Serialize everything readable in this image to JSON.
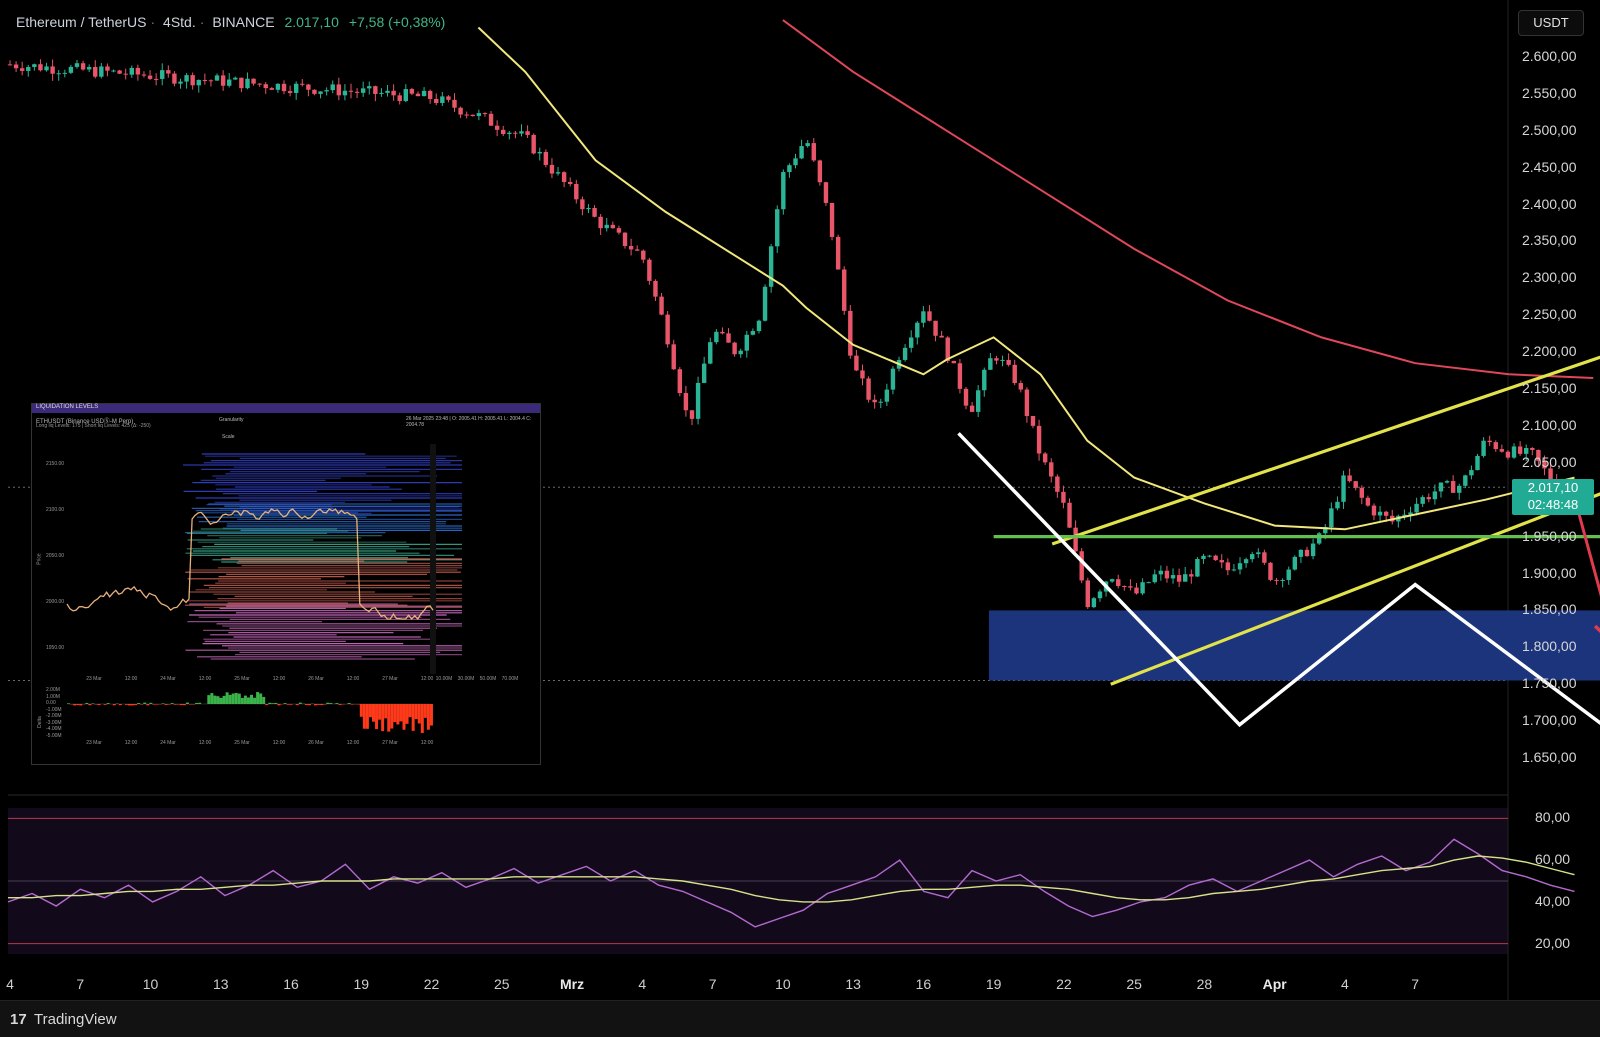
{
  "header": {
    "symbol": "Ethereum / TetherUS",
    "interval": "4Std.",
    "exchange": "BINANCE",
    "price": "2.017,10",
    "change": "+7,58 (+0,38%)"
  },
  "currency_button": "USDT",
  "price_tag": {
    "price": "2.017,10",
    "countdown": "02:48:48"
  },
  "footer": {
    "brand": "TradingView"
  },
  "colors": {
    "background": "#000000",
    "candle_up": "#2bb596",
    "candle_down": "#e9566a",
    "ma_fast": "#f1e77a",
    "ma_slow": "#e0475a",
    "channel": "#e2e24a",
    "support_line": "#63c04e",
    "demand_zone": "#1e3a8a",
    "projection": "#ffffff",
    "down_arrow": "#e03a4f",
    "rsi_line": "#b36ad0",
    "rsi_ma": "#d6e28a"
  },
  "inset": {
    "title": "LIQUIDATION LEVELS",
    "symbol": "ETHUSDT (Binance USDⓈ-M Perp)",
    "subtitle": "Long liq Levels: 175 | Short liq Levels: 425 (Δ: -250)",
    "ohlc": "26 Mar 2025 23:48 | O: 2005.41 H: 2005.41 L: 2004.4 C: 2004.78",
    "granularity_label": "Granularity",
    "scale_label": "Scale",
    "y_ticks": [
      "2150.00",
      "2100.00",
      "2050.00",
      "2000.00",
      "1950.00"
    ],
    "x_ticks": [
      "23 Mar",
      "12:00",
      "24 Mar",
      "12:00",
      "25 Mar",
      "12:00",
      "26 Mar",
      "12:00",
      "27 Mar",
      "12:00"
    ],
    "hist_ticks": [
      "10.00M",
      "30.00M",
      "50.00M",
      "70.00M"
    ],
    "delta_ticks": [
      "2.00M",
      "1.00M",
      "0.00",
      "-1.00M",
      "-2.00M",
      "-3.00M",
      "-4.00M",
      "-5.00M"
    ],
    "price_axis": "Price",
    "delta_axis": "Delta"
  },
  "chart_data": {
    "type": "candlestick",
    "title": "Ethereum / TetherUS · 4Std. · BINANCE",
    "y_axis": {
      "ticks": [
        "2.600,00",
        "2.550,00",
        "2.500,00",
        "2.450,00",
        "2.400,00",
        "2.350,00",
        "2.300,00",
        "2.250,00",
        "2.200,00",
        "2.150,00",
        "2.100,00",
        "2.050,00",
        "2.000,00",
        "1.950,00",
        "1.900,00",
        "1.850,00",
        "1.800,00",
        "1.750,00",
        "1.700,00",
        "1.650,00"
      ],
      "range": [
        1630,
        2625
      ]
    },
    "x_axis": {
      "ticks": [
        "4",
        "7",
        "10",
        "13",
        "16",
        "19",
        "22",
        "25",
        "Mrz",
        "4",
        "7",
        "10",
        "13",
        "16",
        "19",
        "22",
        "25",
        "28",
        "Apr",
        "4",
        "7"
      ]
    },
    "price_path": [
      {
        "t": 0,
        "p": 2590
      },
      {
        "t": 18,
        "p": 2545
      },
      {
        "t": 20,
        "p": 2520
      },
      {
        "t": 22,
        "p": 2490
      },
      {
        "t": 25,
        "p": 2380
      },
      {
        "t": 27,
        "p": 2330
      },
      {
        "t": 28,
        "p": 2230
      },
      {
        "t": 29,
        "p": 2100
      },
      {
        "t": 30,
        "p": 2230
      },
      {
        "t": 31,
        "p": 2200
      },
      {
        "t": 32,
        "p": 2250
      },
      {
        "t": 33,
        "p": 2440
      },
      {
        "t": 34,
        "p": 2490
      },
      {
        "t": 35,
        "p": 2380
      },
      {
        "t": 36,
        "p": 2180
      },
      {
        "t": 37,
        "p": 2120
      },
      {
        "t": 38,
        "p": 2200
      },
      {
        "t": 39,
        "p": 2260
      },
      {
        "t": 40,
        "p": 2200
      },
      {
        "t": 41,
        "p": 2120
      },
      {
        "t": 42,
        "p": 2200
      },
      {
        "t": 43,
        "p": 2160
      },
      {
        "t": 44,
        "p": 2060
      },
      {
        "t": 45,
        "p": 1990
      },
      {
        "t": 46,
        "p": 1860
      },
      {
        "t": 47,
        "p": 1900
      },
      {
        "t": 48,
        "p": 1870
      },
      {
        "t": 49,
        "p": 1900
      },
      {
        "t": 50,
        "p": 1890
      },
      {
        "t": 51,
        "p": 1920
      },
      {
        "t": 52,
        "p": 1905
      },
      {
        "t": 53,
        "p": 1935
      },
      {
        "t": 54,
        "p": 1890
      },
      {
        "t": 55,
        "p": 1920
      },
      {
        "t": 56,
        "p": 1950
      },
      {
        "t": 57,
        "p": 2030
      },
      {
        "t": 58,
        "p": 1990
      },
      {
        "t": 59,
        "p": 1970
      },
      {
        "t": 60,
        "p": 1995
      },
      {
        "t": 61,
        "p": 2015
      },
      {
        "t": 62,
        "p": 2020
      },
      {
        "t": 63,
        "p": 2080
      },
      {
        "t": 64,
        "p": 2065
      },
      {
        "t": 65,
        "p": 2060
      },
      {
        "t": 66,
        "p": 2020
      },
      {
        "t": 66.8,
        "p": 2017
      }
    ],
    "ma_fast": [
      {
        "t": 20,
        "p": 2640
      },
      {
        "t": 22,
        "p": 2580
      },
      {
        "t": 25,
        "p": 2460
      },
      {
        "t": 28,
        "p": 2390
      },
      {
        "t": 31,
        "p": 2330
      },
      {
        "t": 33,
        "p": 2290
      },
      {
        "t": 34,
        "p": 2260
      },
      {
        "t": 36,
        "p": 2210
      },
      {
        "t": 39,
        "p": 2170
      },
      {
        "t": 40,
        "p": 2190
      },
      {
        "t": 42,
        "p": 2220
      },
      {
        "t": 44,
        "p": 2170
      },
      {
        "t": 46,
        "p": 2080
      },
      {
        "t": 48,
        "p": 2030
      },
      {
        "t": 51,
        "p": 1995
      },
      {
        "t": 54,
        "p": 1965
      },
      {
        "t": 57,
        "p": 1960
      },
      {
        "t": 60,
        "p": 1980
      },
      {
        "t": 63,
        "p": 2000
      },
      {
        "t": 66.8,
        "p": 2030
      }
    ],
    "ma_slow": [
      {
        "t": 33,
        "p": 2650
      },
      {
        "t": 36,
        "p": 2580
      },
      {
        "t": 40,
        "p": 2500
      },
      {
        "t": 44,
        "p": 2420
      },
      {
        "t": 48,
        "p": 2340
      },
      {
        "t": 52,
        "p": 2270
      },
      {
        "t": 56,
        "p": 2220
      },
      {
        "t": 60,
        "p": 2185
      },
      {
        "t": 64,
        "p": 2170
      },
      {
        "t": 67.6,
        "p": 2165
      }
    ],
    "channel": {
      "upper": [
        {
          "t": 44.5,
          "p": 1940
        },
        {
          "t": 69,
          "p": 2205
        }
      ],
      "lower": [
        {
          "t": 47,
          "p": 1750
        },
        {
          "t": 70.5,
          "p": 2040
        }
      ]
    },
    "support_level": {
      "p": 1950,
      "t_from": 42,
      "t_to": 79.5
    },
    "demand_zone": {
      "p_low": 1755,
      "p_high": 1850,
      "t_from": 41.8,
      "t_to": 77
    },
    "projection_path": [
      {
        "t": 40.5,
        "p": 2090
      },
      {
        "t": 52.5,
        "p": 1695
      },
      {
        "t": 60,
        "p": 1885
      },
      {
        "t": 68,
        "p": 1695
      },
      {
        "t": 82.5,
        "p": 2275
      }
    ],
    "down_arrow": [
      {
        "t": 66.7,
        "p": 2015
      },
      {
        "t": 68.5,
        "p": 1805
      }
    ],
    "rsi": {
      "range": [
        15,
        85
      ],
      "ticks": [
        "80,00",
        "60,00",
        "40,00",
        "20,00"
      ],
      "bands": [
        80,
        50,
        20
      ],
      "values": [
        40,
        44,
        38,
        46,
        42,
        48,
        40,
        45,
        52,
        43,
        48,
        55,
        47,
        50,
        58,
        46,
        52,
        49,
        54,
        47,
        51,
        56,
        49,
        53,
        57,
        50,
        55,
        48,
        45,
        40,
        35,
        28,
        32,
        36,
        44,
        48,
        52,
        60,
        45,
        42,
        55,
        50,
        53,
        45,
        38,
        33,
        36,
        40,
        42,
        48,
        51,
        45,
        50,
        55,
        60,
        52,
        58,
        62,
        55,
        59,
        70,
        63,
        55,
        52,
        48,
        45
      ],
      "ma_values": [
        42,
        42,
        43,
        43,
        44,
        45,
        45,
        46,
        46,
        47,
        48,
        48,
        49,
        50,
        50,
        50,
        51,
        51,
        51,
        51,
        51,
        52,
        52,
        52,
        52,
        52,
        52,
        51,
        50,
        48,
        46,
        43,
        41,
        40,
        40,
        41,
        43,
        45,
        46,
        46,
        47,
        48,
        48,
        47,
        46,
        44,
        42,
        41,
        41,
        42,
        44,
        45,
        46,
        48,
        50,
        51,
        53,
        55,
        56,
        57,
        60,
        62,
        61,
        59,
        56,
        53
      ]
    }
  }
}
